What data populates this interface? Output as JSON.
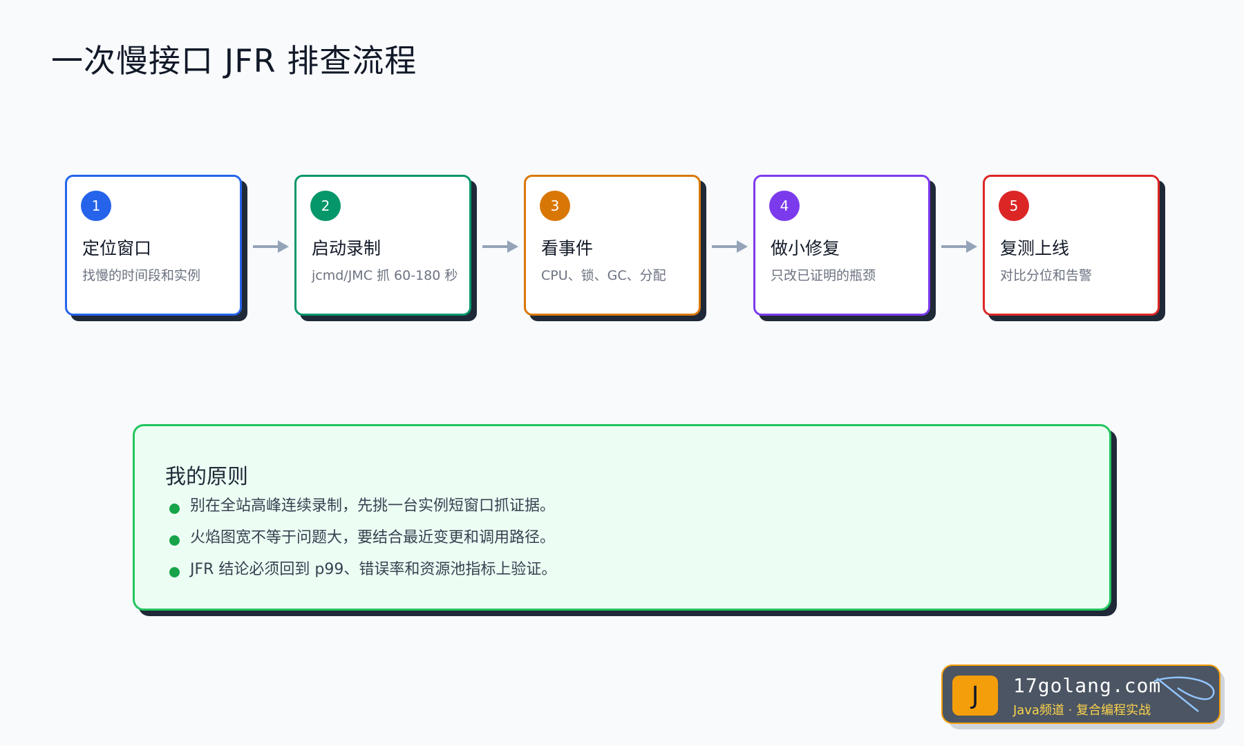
{
  "title": "一次慢接口 JFR 排查流程",
  "steps": [
    {
      "num": "1",
      "title": "定位窗口",
      "desc": "找慢的时间段和实例",
      "color": "#2563eb"
    },
    {
      "num": "2",
      "title": "启动录制",
      "desc": "jcmd/JMC 抓 60-180 秒",
      "color": "#059669"
    },
    {
      "num": "3",
      "title": "看事件",
      "desc": "CPU、锁、GC、分配",
      "color": "#d97706"
    },
    {
      "num": "4",
      "title": "做小修复",
      "desc": "只改已证明的瓶颈",
      "color": "#7c3aed"
    },
    {
      "num": "5",
      "title": "复测上线",
      "desc": "对比分位和告警",
      "color": "#dc2626"
    }
  ],
  "principles": {
    "title": "我的原则",
    "items": [
      "别在全站高峰连续录制，先挑一台实例短窗口抓证据。",
      "火焰图宽不等于问题大，要结合最近变更和调用路径。",
      "JFR 结论必须回到 p99、错误率和资源池指标上验证。"
    ]
  },
  "logo": {
    "letter": "J",
    "domain": "17golang.com",
    "tagline": "Java频道 · 复合编程实战"
  },
  "colors": {
    "arrow": "#94a3b8",
    "principles_border": "#22c55e",
    "principles_bg": "#ecfdf3",
    "bullet": "#16a34a",
    "logo_accent": "#f59e0b"
  }
}
